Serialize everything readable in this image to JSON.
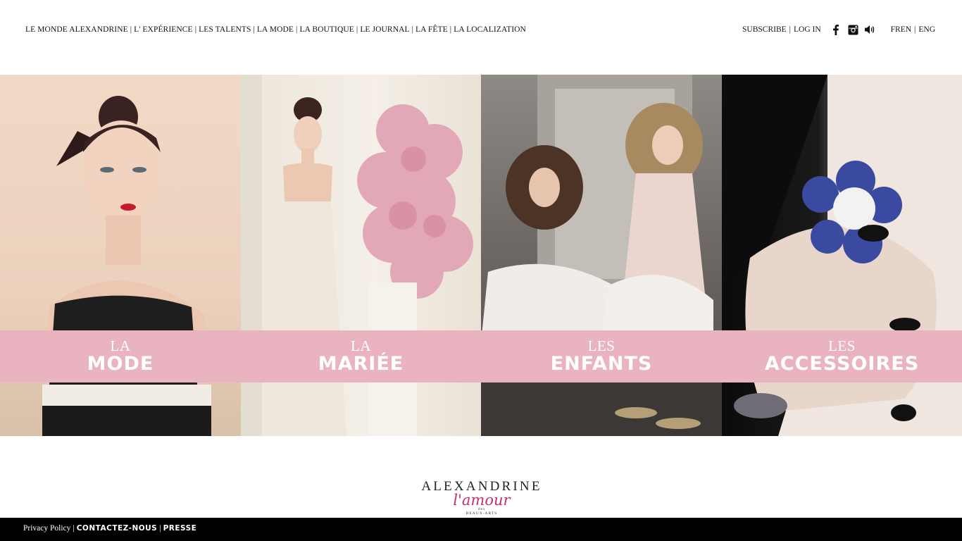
{
  "nav": {
    "items": [
      "LE MONDE ALEXANDRINE",
      "L' EXPÉRIENCE",
      "LES TALENTS",
      "LA MODE",
      "LA BOUTIQUE",
      "LE JOURNAL",
      "LA FÊTE",
      "LA LOCALIZATION"
    ],
    "separator": "|"
  },
  "util": {
    "subscribe": "SUBSCRIBE",
    "login": "LOG IN",
    "lang_fr": "FREN",
    "lang_en": "ENG",
    "separator": "|",
    "icons": [
      "facebook-icon",
      "instagram-icon",
      "sound-icon"
    ]
  },
  "panels": [
    {
      "small": "LA",
      "big": "MODE"
    },
    {
      "small": "LA",
      "big": "MARIÉE"
    },
    {
      "small": "LES",
      "big": "ENFANTS"
    },
    {
      "small": "LES",
      "big": "ACCESSOIRES"
    }
  ],
  "logo": {
    "wordmark": "ALEXANDRINE",
    "script": "l'amour",
    "small1": "des",
    "small2": "BEAUX-ARTS"
  },
  "footer": {
    "privacy": "Privacy Policy",
    "contact": "CONTACTEZ-NOUS",
    "press": "PRESSE",
    "separator": "|"
  },
  "colors": {
    "banner": "#e9b3c0",
    "footer_bg": "#000000",
    "logo_script": "#c2306e"
  }
}
